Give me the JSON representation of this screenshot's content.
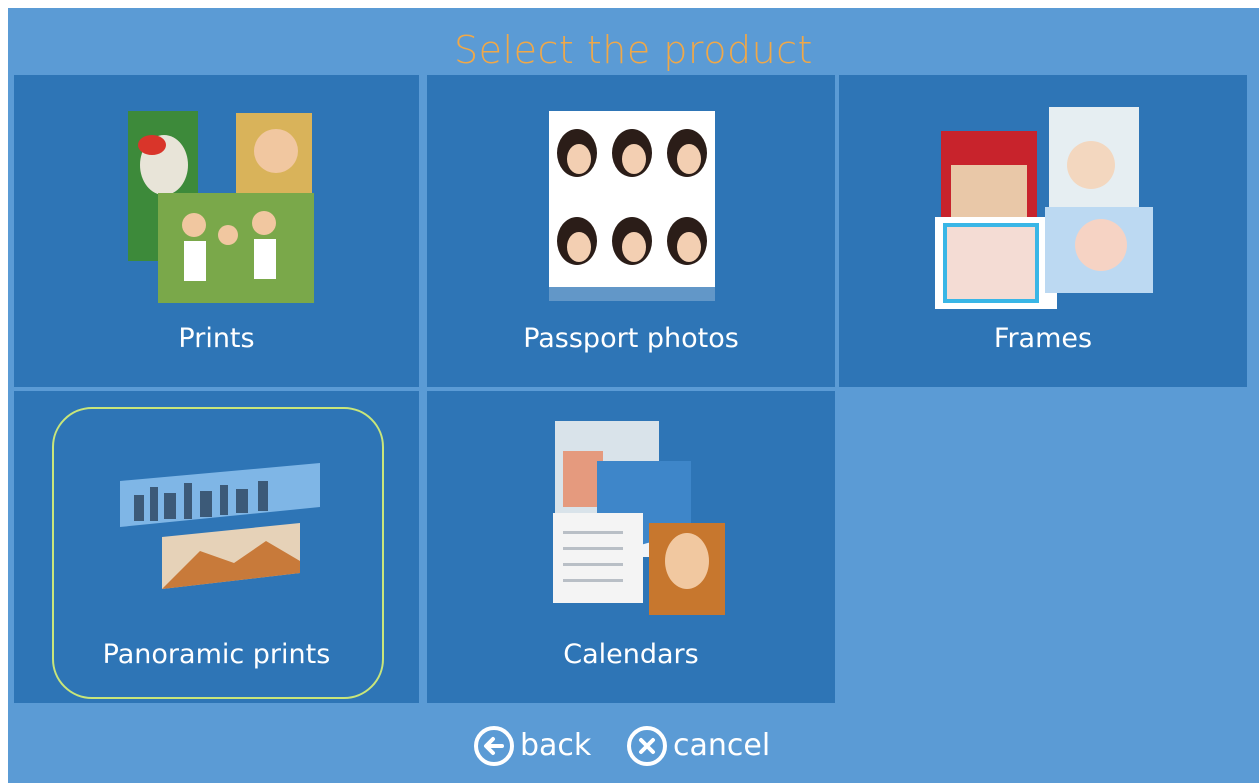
{
  "header": {
    "title": "Select the product"
  },
  "tiles": [
    {
      "label": "Prints",
      "icon": "prints-collage-icon"
    },
    {
      "label": "Passport photos",
      "icon": "passport-photos-icon"
    },
    {
      "label": "Frames",
      "icon": "frames-collage-icon"
    },
    {
      "label": "Panoramic prints",
      "icon": "panoramic-prints-icon"
    },
    {
      "label": "Calendars",
      "icon": "calendars-icon"
    }
  ],
  "nav": {
    "back_label": "back",
    "cancel_label": "cancel"
  },
  "colors": {
    "background": "#5b9bd5",
    "tile": "#2e75b6",
    "title": "#f0a848",
    "focus": "#c9e67a",
    "text": "#ffffff"
  }
}
